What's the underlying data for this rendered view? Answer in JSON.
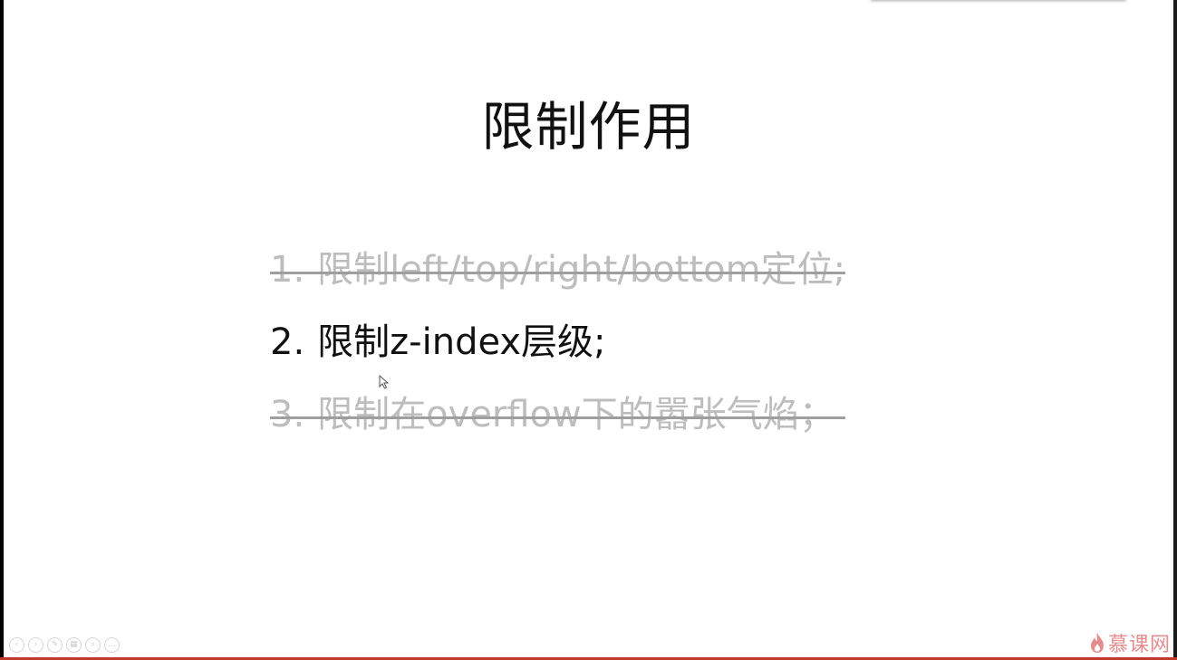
{
  "slide": {
    "title": "限制作用",
    "items": [
      {
        "number": "1.",
        "text": "限制left/top/right/bottom定位;",
        "state": "struck"
      },
      {
        "number": "2.",
        "text": "限制z-index层级;",
        "state": "current"
      },
      {
        "number": "3.",
        "text": "限制在overflow下的嚣张气焰；",
        "state": "struck"
      }
    ]
  },
  "controls": [
    {
      "name": "previous-slide",
      "icon": "chevron-left-icon",
      "glyph": "‹"
    },
    {
      "name": "next-slide",
      "icon": "chevron-right-icon",
      "glyph": "›"
    },
    {
      "name": "pen",
      "icon": "pen-icon",
      "glyph": "✎"
    },
    {
      "name": "slides-overview",
      "icon": "grid-icon",
      "glyph": "▦"
    },
    {
      "name": "zoom",
      "icon": "zoom-icon",
      "glyph": "⌕"
    },
    {
      "name": "more-options",
      "icon": "ellipsis-icon",
      "glyph": "…"
    }
  ],
  "watermark": {
    "text": "慕课网",
    "icon": "flame-logo-icon",
    "color": "#e58c8c"
  },
  "colors": {
    "struck_text": "#bdbdbd",
    "current_text": "#111111",
    "bottom_accent": "#c0392b"
  }
}
